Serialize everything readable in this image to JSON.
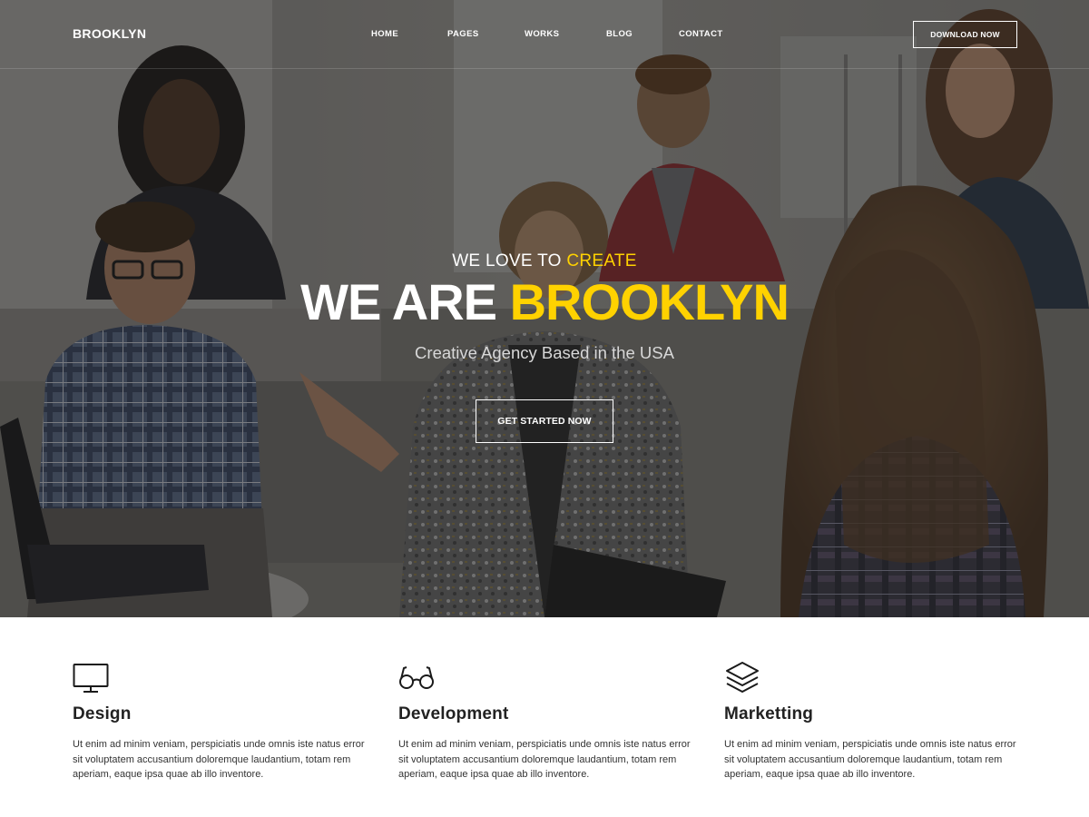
{
  "nav": {
    "logo": "BROOKLYN",
    "items": [
      {
        "label": "HOME"
      },
      {
        "label": "PAGES"
      },
      {
        "label": "WORKS"
      },
      {
        "label": "BLOG"
      },
      {
        "label": "CONTACT"
      }
    ],
    "download_label": "DOWNLOAD NOW"
  },
  "hero": {
    "kicker_prefix": "WE LOVE TO ",
    "kicker_accent": "CREATE",
    "headline_prefix": "WE ARE ",
    "headline_accent": "BROOKLYN",
    "tagline": "Creative Agency Based in the USA",
    "cta_label": "GET STARTED NOW",
    "accent_color": "#ffd200"
  },
  "features": [
    {
      "icon": "monitor-icon",
      "title": "Design",
      "text": "Ut enim ad minim veniam,  perspiciatis unde omnis iste natus error sit voluptatem accusantium doloremque laudantium, totam rem aperiam, eaque ipsa quae ab illo inventore."
    },
    {
      "icon": "glasses-icon",
      "title": "Development",
      "text": "Ut enim ad minim veniam,  perspiciatis unde omnis iste natus error sit voluptatem accusantium doloremque laudantium, totam rem aperiam, eaque ipsa quae ab illo inventore."
    },
    {
      "icon": "layers-icon",
      "title": "Marketting",
      "text": "Ut enim ad minim veniam,  perspiciatis unde omnis iste natus error sit voluptatem accusantium doloremque laudantium, totam rem aperiam, eaque ipsa quae ab illo inventore."
    }
  ]
}
